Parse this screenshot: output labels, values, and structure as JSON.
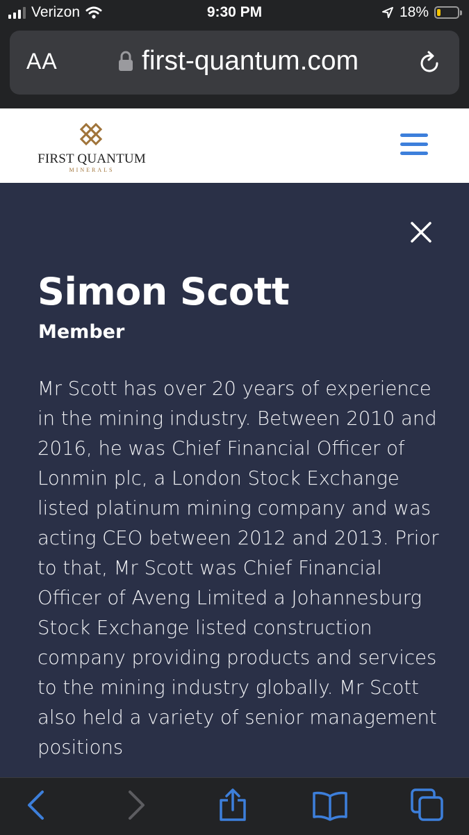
{
  "status_bar": {
    "carrier": "Verizon",
    "time": "9:30 PM",
    "battery_percent": "18%",
    "battery_level": 0.18,
    "signal_bars": 3,
    "icons": [
      "signal-icon",
      "wifi-icon",
      "location-arrow-icon",
      "battery-icon"
    ]
  },
  "browser": {
    "reader_label": "AA",
    "url": "first-quantum.com",
    "icons": [
      "lock-icon",
      "reload-icon"
    ]
  },
  "header": {
    "logo_title": "FIRST QUANTUM",
    "logo_subtitle": "MINERALS",
    "brand_color": "#a0743a",
    "menu_icon": "hamburger-icon",
    "menu_color": "#3d7fdb"
  },
  "bio": {
    "name": "Simon Scott",
    "role": "Member",
    "text": "Mr Scott has over 20 years of experience in the mining industry. Between 2010 and 2016, he was Chief Financial Officer of Lonmin plc, a London Stock Exchange listed platinum mining company and was acting CEO between 2012 and 2013. Prior to that, Mr Scott was Chief Financial Officer of Aveng Limited a Johannesburg Stock Exchange listed construction company providing products and services to the mining industry globally. Mr Scott also held a variety of senior management positions",
    "close_icon": "close-icon",
    "background": "#2a3047"
  },
  "toolbar": {
    "buttons": [
      "back-icon",
      "forward-icon",
      "share-icon",
      "bookmarks-icon",
      "tabs-icon"
    ],
    "accent": "#3d7fdb"
  }
}
